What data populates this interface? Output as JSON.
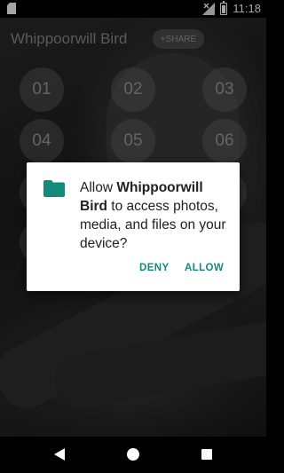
{
  "status_bar": {
    "time": "11:18"
  },
  "app": {
    "title": "Whippoorwill Bird",
    "share_label": "+SHARE"
  },
  "number_buttons": [
    "01",
    "02",
    "03",
    "04",
    "05",
    "06"
  ],
  "dialog": {
    "prefix": "Allow ",
    "app_name": "Whippoorwill Bird",
    "suffix": " to access photos, media, and files on your device?",
    "deny_label": "DENY",
    "allow_label": "ALLOW",
    "accent_color": "#128a7c",
    "icon": "folder-icon"
  },
  "nav": {
    "icons": [
      "back-icon",
      "home-icon",
      "recents-icon"
    ]
  }
}
